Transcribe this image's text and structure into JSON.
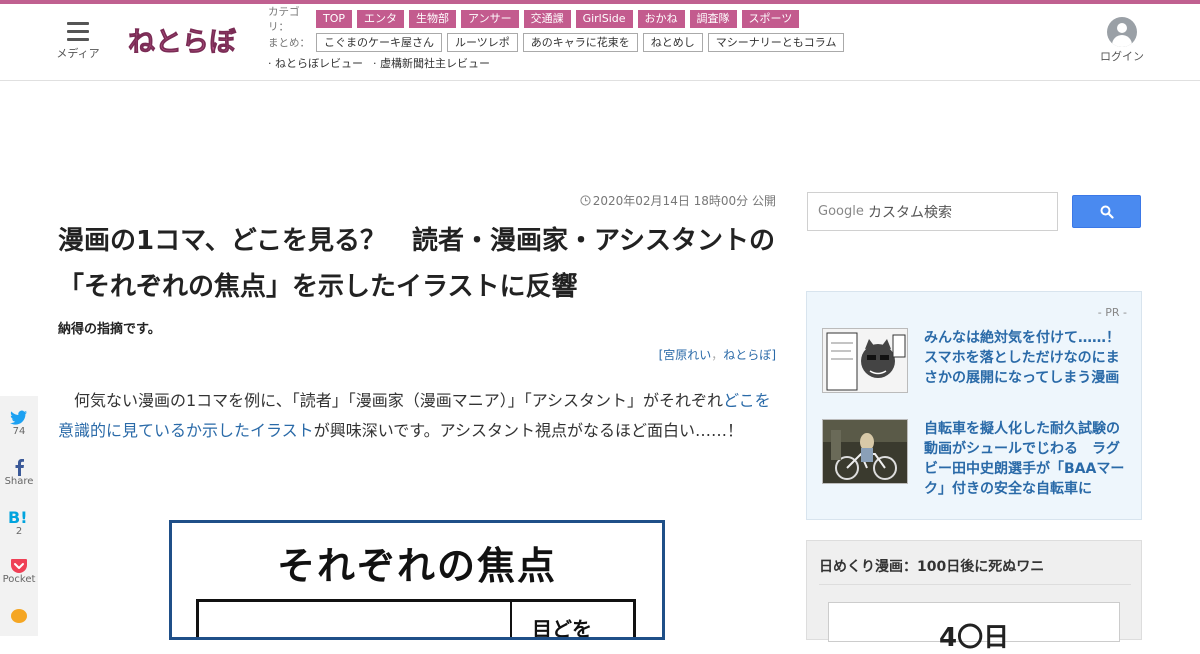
{
  "header": {
    "menu_label": "メディア",
    "logo_text": "ねとらぼ",
    "category_key": "カテゴリ：",
    "categories": [
      "TOP",
      "エンタ",
      "生物部",
      "アンサー",
      "交通課",
      "GirlSide",
      "おかね",
      "調査隊",
      "スポーツ"
    ],
    "matome_key": "まとめ：",
    "matome": [
      "こぐまのケーキ屋さん",
      "ルーツレポ",
      "あのキャラに花束を",
      "ねとめし",
      "マシーナリーともコラム"
    ],
    "reviews": [
      "· ねとらぼレビュー",
      "· 虚構新聞社主レビュー"
    ],
    "login_label": "ログイン"
  },
  "article": {
    "date": "2020年02月14日 18時00分 公開",
    "title": "漫画の1コマ、どこを見る？　読者・漫画家・アシスタントの「それぞれの焦点」を示したイラストに反響",
    "subtitle": "納得の指摘です。",
    "byline_open": "[",
    "author": "宮原れい",
    "byline_sep": "，",
    "site": "ねとらぼ",
    "byline_close": "]",
    "body_pre": "　何気ない漫画の1コマを例に、「読者」「漫画家（漫画マニア）」「アシスタント」がそれぞれ",
    "body_link": "どこを意識的に見ているか示したイラスト",
    "body_post": "が興味深いです。アシスタント視点がなるほど面白い……！",
    "image_title": "それぞれの焦点",
    "image_bubble": "目どを"
  },
  "share": {
    "twitter_count": "74",
    "facebook_label": "Share",
    "hatena_count": "2",
    "pocket_label": "Pocket"
  },
  "search": {
    "google_label": "Google",
    "placeholder": "カスタム検索"
  },
  "pr": {
    "label": "- PR -",
    "items": [
      {
        "text": "みんなは絶対気を付けて……！　スマホを落としただけなのにまさかの展開になってしまう漫画"
      },
      {
        "text": "自転車を擬人化した耐久試験の動画がシュールでじわる　ラグビー田中史朗選手が「BAAマーク」付きの安全な自転車に"
      }
    ]
  },
  "sidebar2": {
    "heading": "日めくり漫画：100日後に死ぬワニ",
    "inner_text": "4〇日"
  },
  "colors": {
    "brand_pink": "#c35b8e",
    "link_blue": "#2a6aa8",
    "search_blue": "#4a8af0"
  }
}
